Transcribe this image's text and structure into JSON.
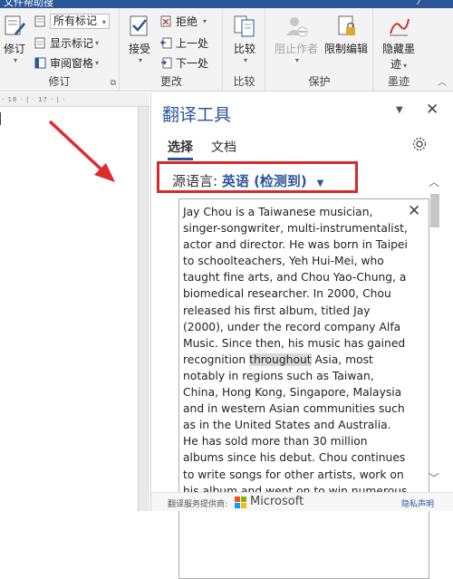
{
  "titlebar": {
    "doc_title": "文件帮助搜"
  },
  "ribbon": {
    "groups": {
      "tracking": {
        "label": "修订",
        "track_changes": "修订",
        "markup_select": "所有标记",
        "show_markup": "显示标记",
        "review_pane": "审阅窗格"
      },
      "changes": {
        "label": "更改",
        "accept": "接受",
        "reject": "拒绝",
        "previous": "上一处",
        "next": "下一处"
      },
      "compare": {
        "label": "比较",
        "compare": "比较"
      },
      "protect": {
        "label": "保护",
        "block_authors": "阻止作者",
        "restrict_editing": "限制编辑"
      },
      "ink": {
        "label": "墨迹",
        "hide_ink": "隐藏墨迹"
      }
    }
  },
  "ruler": {
    "text": "· 16 · | · 17 · | ·"
  },
  "pane": {
    "title": "翻译工具",
    "tabs": [
      {
        "label": "选择"
      },
      {
        "label": "文档"
      }
    ],
    "source_language_label": "源语言:",
    "source_language_value": "英语 (检测到)",
    "source_text": {
      "part1": "Jay Chou is a Taiwanese musician, singer-songwriter, multi-instrumentalist, actor and director. He was born in Taipei to schoolteachers, Yeh Hui-Mei, who taught fine arts, and Chou Yao-Chung, a biomedical researcher. In 2000, Chou released his first album, titled Jay (2000), under the record company Alfa Music. Since then, his music has gained recognition ",
      "highlight": "throughout",
      "part2": " Asia, most notably in regions such as Taiwan, China, Hong Kong, Singapore, Malaysia and in western Asian communities such as in the United States and Australia. He has sold more than 30 million albums since his debut. Chou continues to write songs for other artists, work on his album and went on to win numerous awards in the music"
    },
    "footer": {
      "provider_label": "翻译服务提供商:",
      "provider_name": "Microsoft",
      "privacy": "隐私声明"
    }
  },
  "colors": {
    "accent": "#2b579a",
    "annotation_red": "#d62a2a",
    "ms_red": "#f25022",
    "ms_green": "#7fba00",
    "ms_blue": "#00a4ef",
    "ms_yellow": "#ffb900"
  },
  "icons": [
    "track-changes-icon",
    "show-markup-icon",
    "review-pane-icon",
    "accept-icon",
    "reject-icon",
    "previous-icon",
    "next-icon",
    "compare-icon",
    "block-authors-icon",
    "restrict-editing-icon",
    "hide-ink-icon",
    "gear-icon",
    "close-icon",
    "dropdown-caret-icon",
    "microsoft-logo-icon"
  ]
}
